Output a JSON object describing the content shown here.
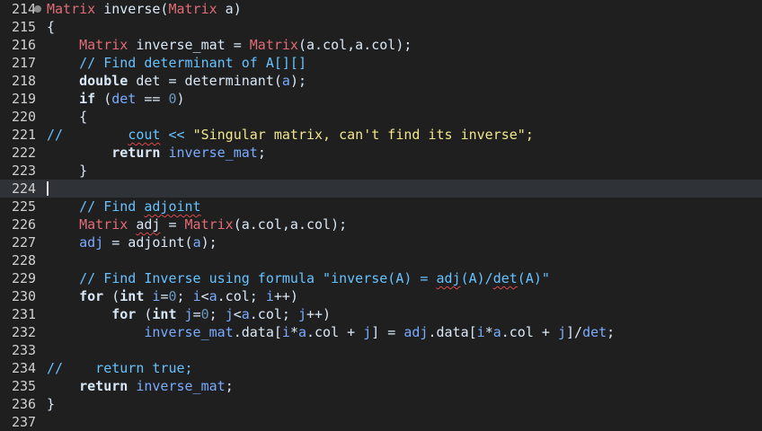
{
  "lines": [
    {
      "n": "214",
      "fold": true,
      "tokens": [
        {
          "t": "Matrix",
          "c": "type"
        },
        {
          "t": " inverse(",
          "c": "plain"
        },
        {
          "t": "Matrix",
          "c": "type"
        },
        {
          "t": " a)",
          "c": "plain"
        }
      ]
    },
    {
      "n": "215",
      "tokens": [
        {
          "t": "{",
          "c": "plain"
        }
      ]
    },
    {
      "n": "216",
      "tokens": [
        {
          "t": "    ",
          "c": "plain"
        },
        {
          "t": "Matrix",
          "c": "type"
        },
        {
          "t": " inverse_mat = ",
          "c": "plain"
        },
        {
          "t": "Matrix",
          "c": "type"
        },
        {
          "t": "(a.col,a.col);",
          "c": "plain"
        }
      ]
    },
    {
      "n": "217",
      "tokens": [
        {
          "t": "    // Find determinant of A[][]",
          "c": "cm"
        }
      ]
    },
    {
      "n": "218",
      "tokens": [
        {
          "t": "    ",
          "c": "plain"
        },
        {
          "t": "double",
          "c": "kw2"
        },
        {
          "t": " det = determinant(",
          "c": "plain"
        },
        {
          "t": "a",
          "c": "var"
        },
        {
          "t": ");",
          "c": "plain"
        }
      ]
    },
    {
      "n": "219",
      "tokens": [
        {
          "t": "    ",
          "c": "plain"
        },
        {
          "t": "if",
          "c": "kw2"
        },
        {
          "t": " (",
          "c": "plain"
        },
        {
          "t": "det",
          "c": "var"
        },
        {
          "t": " == ",
          "c": "plain"
        },
        {
          "t": "0",
          "c": "num"
        },
        {
          "t": ")",
          "c": "plain"
        }
      ]
    },
    {
      "n": "220",
      "tokens": [
        {
          "t": "    {",
          "c": "plain"
        }
      ]
    },
    {
      "n": "221",
      "tokens": [
        {
          "t": "//        ",
          "c": "cm"
        },
        {
          "t": "cout",
          "c": "cm",
          "sq": true
        },
        {
          "t": " << ",
          "c": "cm"
        },
        {
          "t": "\"Singular matrix, can't find its inverse\";",
          "c": "str"
        }
      ]
    },
    {
      "n": "222",
      "tokens": [
        {
          "t": "        ",
          "c": "plain"
        },
        {
          "t": "return",
          "c": "kw2"
        },
        {
          "t": " ",
          "c": "plain"
        },
        {
          "t": "inverse_mat",
          "c": "var"
        },
        {
          "t": ";",
          "c": "plain"
        }
      ]
    },
    {
      "n": "223",
      "tokens": [
        {
          "t": "    }",
          "c": "plain"
        }
      ]
    },
    {
      "n": "224",
      "current": true,
      "tokens": []
    },
    {
      "n": "225",
      "tokens": [
        {
          "t": "    // Find ",
          "c": "cm"
        },
        {
          "t": "adjoint",
          "c": "cm",
          "sq": true
        }
      ]
    },
    {
      "n": "226",
      "tokens": [
        {
          "t": "    ",
          "c": "plain"
        },
        {
          "t": "Matrix",
          "c": "type"
        },
        {
          "t": " ",
          "c": "plain"
        },
        {
          "t": "adj",
          "c": "plain",
          "sq": true
        },
        {
          "t": " = ",
          "c": "plain"
        },
        {
          "t": "Matrix",
          "c": "type"
        },
        {
          "t": "(a.col,a.col);",
          "c": "plain"
        }
      ]
    },
    {
      "n": "227",
      "tokens": [
        {
          "t": "    ",
          "c": "plain"
        },
        {
          "t": "adj",
          "c": "var"
        },
        {
          "t": " = adjoint(",
          "c": "plain"
        },
        {
          "t": "a",
          "c": "var"
        },
        {
          "t": ");",
          "c": "plain"
        }
      ]
    },
    {
      "n": "228",
      "tokens": []
    },
    {
      "n": "229",
      "tokens": [
        {
          "t": "    // Find Inverse using formula \"inverse(A) = ",
          "c": "cm"
        },
        {
          "t": "adj",
          "c": "cm",
          "sq": true
        },
        {
          "t": "(A)/",
          "c": "cm"
        },
        {
          "t": "det",
          "c": "cm",
          "sq": true
        },
        {
          "t": "(A)\"",
          "c": "cm"
        }
      ]
    },
    {
      "n": "230",
      "tokens": [
        {
          "t": "    ",
          "c": "plain"
        },
        {
          "t": "for",
          "c": "kw2"
        },
        {
          "t": " (",
          "c": "plain"
        },
        {
          "t": "int",
          "c": "kw2"
        },
        {
          "t": " ",
          "c": "plain"
        },
        {
          "t": "i",
          "c": "var"
        },
        {
          "t": "=",
          "c": "plain"
        },
        {
          "t": "0",
          "c": "num"
        },
        {
          "t": "; ",
          "c": "plain"
        },
        {
          "t": "i",
          "c": "var"
        },
        {
          "t": "<",
          "c": "plain"
        },
        {
          "t": "a",
          "c": "var"
        },
        {
          "t": ".col; ",
          "c": "plain"
        },
        {
          "t": "i",
          "c": "var"
        },
        {
          "t": "++)",
          "c": "plain"
        }
      ]
    },
    {
      "n": "231",
      "tokens": [
        {
          "t": "        ",
          "c": "plain"
        },
        {
          "t": "for",
          "c": "kw2"
        },
        {
          "t": " (",
          "c": "plain"
        },
        {
          "t": "int",
          "c": "kw2"
        },
        {
          "t": " ",
          "c": "plain"
        },
        {
          "t": "j",
          "c": "var"
        },
        {
          "t": "=",
          "c": "plain"
        },
        {
          "t": "0",
          "c": "num"
        },
        {
          "t": "; ",
          "c": "plain"
        },
        {
          "t": "j",
          "c": "var"
        },
        {
          "t": "<",
          "c": "plain"
        },
        {
          "t": "a",
          "c": "var"
        },
        {
          "t": ".col; ",
          "c": "plain"
        },
        {
          "t": "j",
          "c": "var"
        },
        {
          "t": "++)",
          "c": "plain"
        }
      ]
    },
    {
      "n": "232",
      "tokens": [
        {
          "t": "            ",
          "c": "plain"
        },
        {
          "t": "inverse_mat",
          "c": "var"
        },
        {
          "t": ".data[",
          "c": "plain"
        },
        {
          "t": "i",
          "c": "var"
        },
        {
          "t": "*",
          "c": "plain"
        },
        {
          "t": "a",
          "c": "var"
        },
        {
          "t": ".col + ",
          "c": "plain"
        },
        {
          "t": "j",
          "c": "var"
        },
        {
          "t": "] = ",
          "c": "plain"
        },
        {
          "t": "adj",
          "c": "var"
        },
        {
          "t": ".data[",
          "c": "plain"
        },
        {
          "t": "i",
          "c": "var"
        },
        {
          "t": "*",
          "c": "plain"
        },
        {
          "t": "a",
          "c": "var"
        },
        {
          "t": ".col + ",
          "c": "plain"
        },
        {
          "t": "j",
          "c": "var"
        },
        {
          "t": "]/",
          "c": "plain"
        },
        {
          "t": "det",
          "c": "var"
        },
        {
          "t": ";",
          "c": "plain"
        }
      ]
    },
    {
      "n": "233",
      "tokens": []
    },
    {
      "n": "234",
      "tokens": [
        {
          "t": "//    return true;",
          "c": "cm"
        }
      ]
    },
    {
      "n": "235",
      "tokens": [
        {
          "t": "    ",
          "c": "plain"
        },
        {
          "t": "return",
          "c": "kw2"
        },
        {
          "t": " ",
          "c": "plain"
        },
        {
          "t": "inverse_mat",
          "c": "var"
        },
        {
          "t": ";",
          "c": "plain"
        }
      ]
    },
    {
      "n": "236",
      "tokens": [
        {
          "t": "}",
          "c": "plain"
        }
      ]
    },
    {
      "n": "237",
      "tokens": []
    }
  ]
}
